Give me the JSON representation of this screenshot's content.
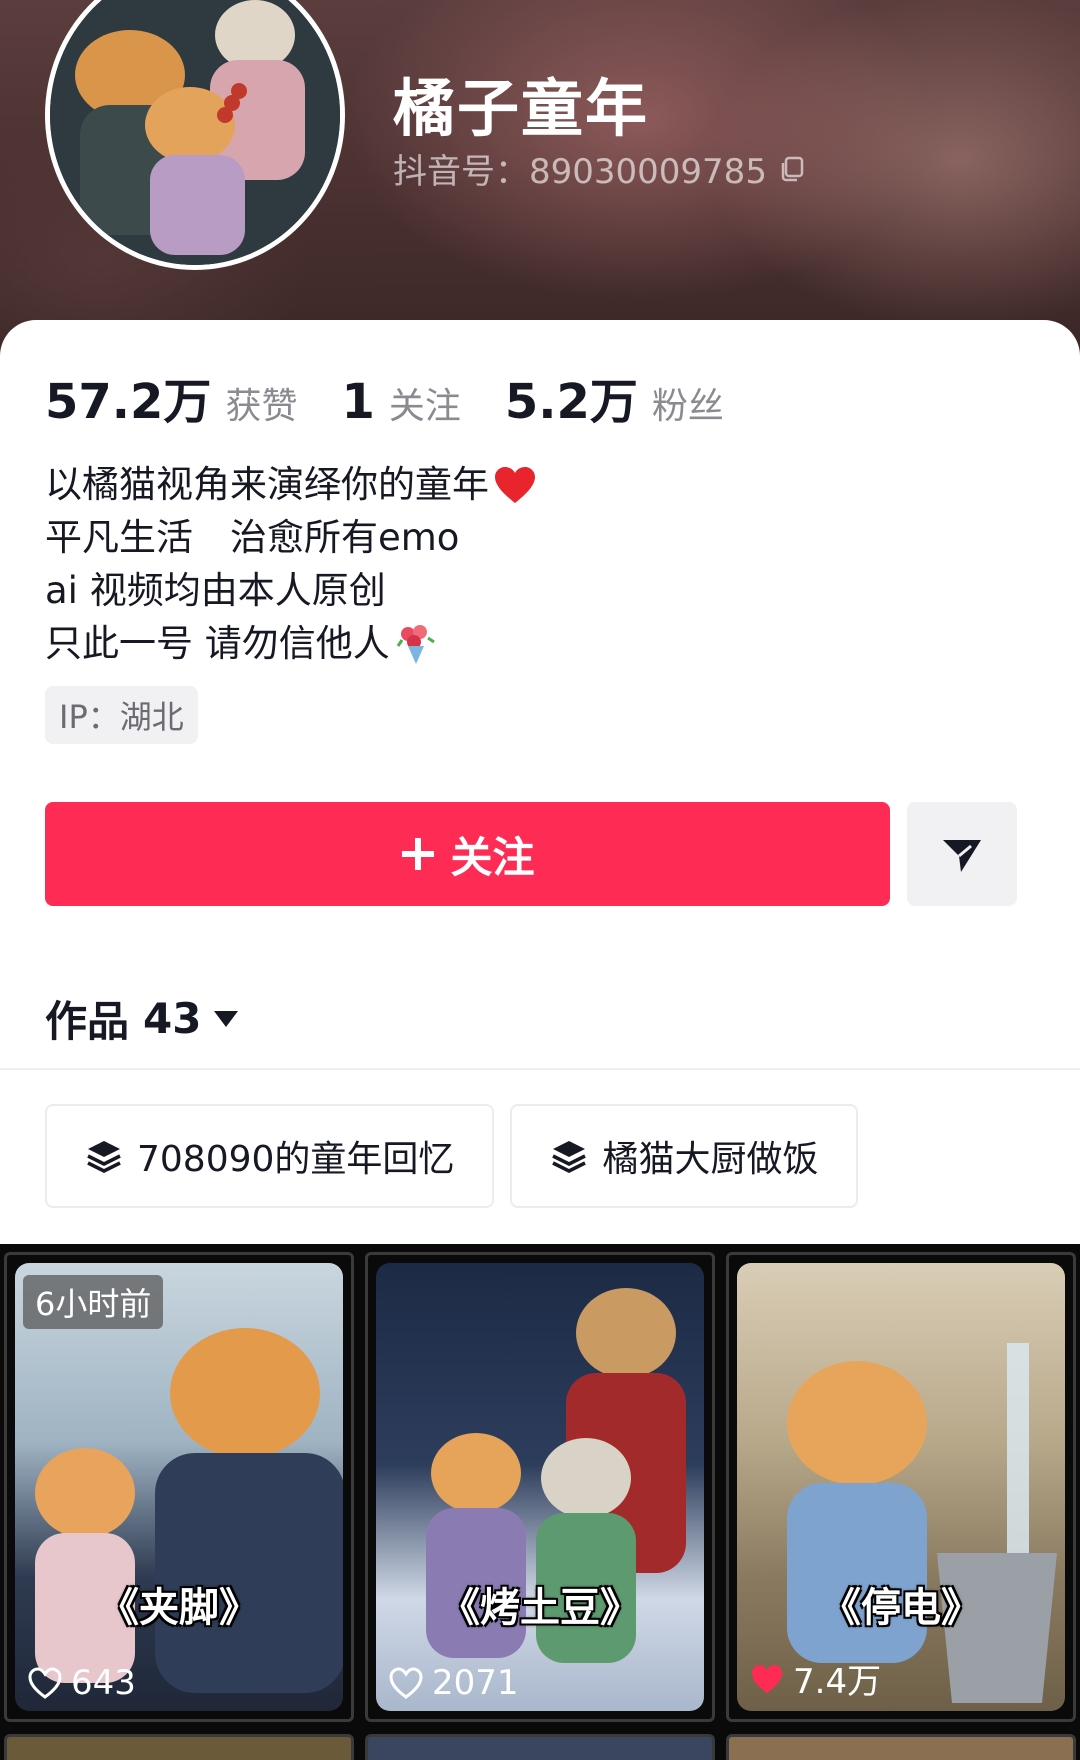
{
  "profile": {
    "name": "橘子童年",
    "douyin_id": "抖音号：89030009785"
  },
  "stats": [
    {
      "value": "57.2万",
      "label": "获赞"
    },
    {
      "value": "1",
      "label": "关注"
    },
    {
      "value": "5.2万",
      "label": "粉丝"
    }
  ],
  "bio": [
    "以橘猫视角来演绎你的童年",
    "平凡生活　治愈所有emo",
    "ai 视频均由本人原创",
    "只此一号 请勿信他人"
  ],
  "ip": "IP：湖北",
  "actions": {
    "follow_label": "关注"
  },
  "works": {
    "label": "作品",
    "count": "43"
  },
  "collections": [
    {
      "title": "708090的童年回忆",
      "icon": "stack-icon"
    },
    {
      "title": "橘猫大厨做饭",
      "icon": "stack-icon"
    }
  ],
  "videos": [
    {
      "badge": "6小时前",
      "title": "《夹脚》",
      "likes": "643",
      "liked": false
    },
    {
      "badge": "",
      "title": "《烤土豆》",
      "likes": "2071",
      "liked": false
    },
    {
      "badge": "",
      "title": "《停电》",
      "likes": "7.4万",
      "liked": true
    }
  ],
  "colors": {
    "accent": "#fe2c55",
    "text": "#161823",
    "muted": "#8a8b91"
  }
}
